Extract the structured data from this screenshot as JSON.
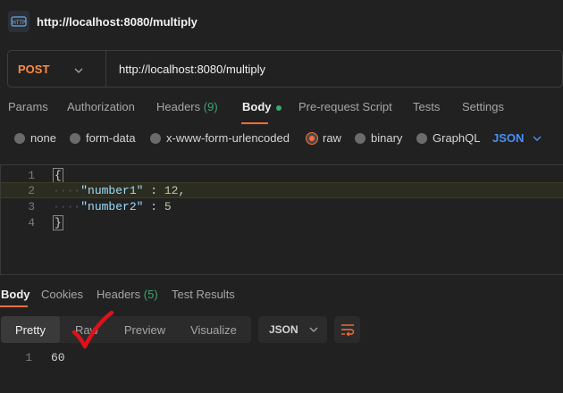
{
  "titlebar": {
    "icon": "http-icon",
    "title": "http://localhost:8080/multiply"
  },
  "request": {
    "method": "POST",
    "url": "http://localhost:8080/multiply",
    "tabs": [
      {
        "label": "Params"
      },
      {
        "label": "Authorization"
      },
      {
        "label": "Headers",
        "count": "(9)"
      },
      {
        "label": "Body",
        "active": true,
        "indicator": "green-dot"
      },
      {
        "label": "Pre-request Script"
      },
      {
        "label": "Tests"
      },
      {
        "label": "Settings"
      }
    ],
    "body_types": [
      "none",
      "form-data",
      "x-www-form-urlencoded",
      "raw",
      "binary",
      "GraphQL"
    ],
    "selected_body_type": "raw",
    "language": "JSON",
    "editor": {
      "line_numbers": [
        "1",
        "2",
        "3",
        "4"
      ],
      "open_brace": "{",
      "close_brace": "}",
      "fields": [
        {
          "key": "\"number1\"",
          "sep": " : ",
          "value": "12",
          "trail": ","
        },
        {
          "key": "\"number2\"",
          "sep": " : ",
          "value": "5",
          "trail": ""
        }
      ]
    }
  },
  "response": {
    "tabs": [
      {
        "label": "Body",
        "active": true
      },
      {
        "label": "Cookies"
      },
      {
        "label": "Headers",
        "count": "(5)"
      },
      {
        "label": "Test Results"
      }
    ],
    "views": [
      "Pretty",
      "Raw",
      "Preview",
      "Visualize"
    ],
    "active_view": "Pretty",
    "format": "JSON",
    "lines": [
      {
        "number": "1",
        "value": "60"
      }
    ]
  },
  "colors": {
    "accent": "#ff6c37",
    "method": "#ff8a3d",
    "link": "#4a8ff5",
    "success": "#3ea66e",
    "annotation": "#e0101a"
  }
}
